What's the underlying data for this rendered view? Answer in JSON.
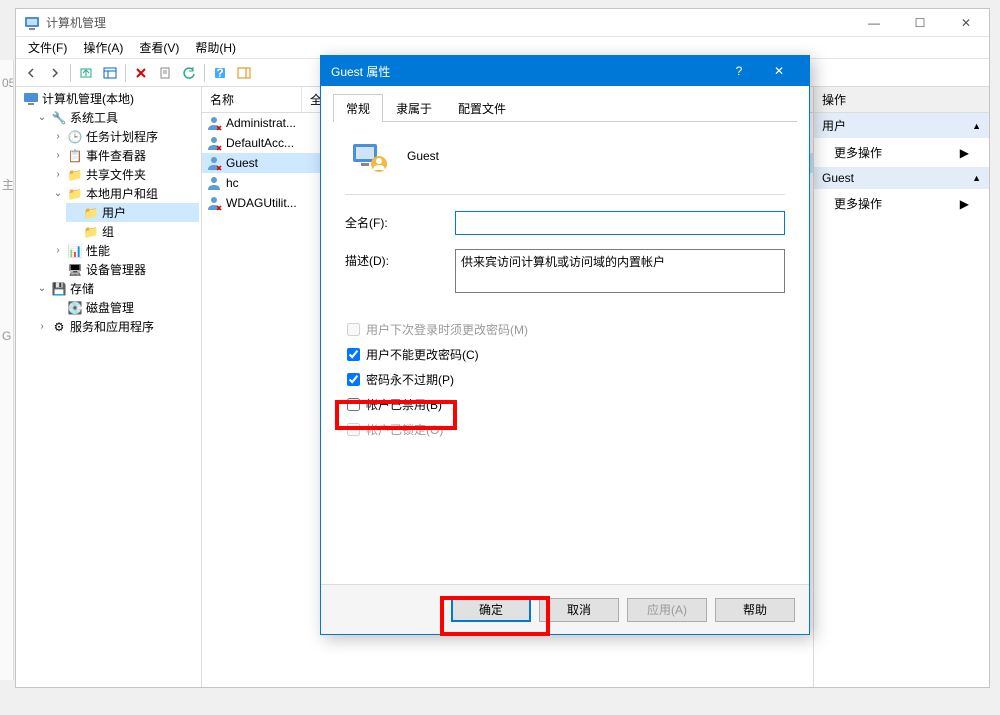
{
  "window": {
    "title": "计算机管理",
    "menu": {
      "file": "文件(F)",
      "action": "操作(A)",
      "view": "查看(V)",
      "help": "帮助(H)"
    },
    "win_controls": {
      "min": "—",
      "max": "☐",
      "close": "✕"
    }
  },
  "tree": {
    "root": "计算机管理(本地)",
    "sys_tools": "系统工具",
    "task_scheduler": "任务计划程序",
    "event_viewer": "事件查看器",
    "shared_folders": "共享文件夹",
    "local_users": "本地用户和组",
    "users": "用户",
    "groups": "组",
    "performance": "性能",
    "device_mgr": "设备管理器",
    "storage": "存储",
    "disk_mgmt": "磁盘管理",
    "services_apps": "服务和应用程序"
  },
  "list": {
    "header_name": "名称",
    "header_fullname": "全",
    "items": {
      "admin": "Administrat...",
      "defacc": "DefaultAcc...",
      "guest": "Guest",
      "hc": "hc",
      "wdag": "WDAGUtilit..."
    }
  },
  "actions": {
    "panel_title": "操作",
    "group1": "用户",
    "group2": "Guest",
    "more": "更多操作"
  },
  "dialog": {
    "title": "Guest 属性",
    "help": "?",
    "close": "✕",
    "tabs": {
      "general": "常规",
      "memberof": "隶属于",
      "profile": "配置文件"
    },
    "username": "Guest",
    "fullname_label": "全名(F):",
    "fullname_value": "",
    "desc_label": "描述(D):",
    "desc_value": "供来宾访问计算机或访问域的内置帐户",
    "check_must_change": "用户下次登录时须更改密码(M)",
    "check_cannot_change": "用户不能更改密码(C)",
    "check_never_expire": "密码永不过期(P)",
    "check_disabled": "帐户已禁用(B)",
    "check_locked": "帐户已锁定(O)",
    "btn_ok": "确定",
    "btn_cancel": "取消",
    "btn_apply": "应用(A)",
    "btn_help": "帮助"
  },
  "left_fragments": [
    "",
    "05",
    "",
    "主",
    "",
    "",
    "G"
  ]
}
